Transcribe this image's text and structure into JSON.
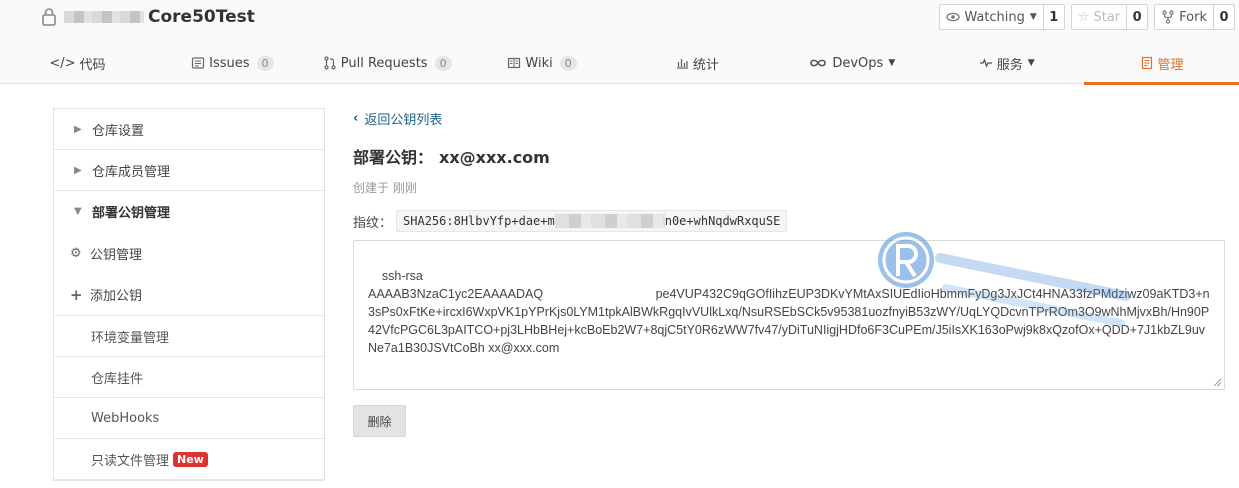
{
  "header": {
    "repo_name": "Core50Test",
    "watching_label": "Watching",
    "watching_count": "1",
    "star_label": "Star",
    "star_count": "0",
    "fork_label": "Fork",
    "fork_count": "0"
  },
  "tabs": [
    {
      "label": "代码",
      "badge": null
    },
    {
      "label": "Issues",
      "badge": "0"
    },
    {
      "label": "Pull Requests",
      "badge": "0"
    },
    {
      "label": "Wiki",
      "badge": "0"
    },
    {
      "label": "统计",
      "badge": null
    },
    {
      "label": "DevOps",
      "badge": null
    },
    {
      "label": "服务",
      "badge": null
    },
    {
      "label": "管理",
      "badge": null
    }
  ],
  "sidebar": {
    "items": [
      {
        "label": "仓库设置"
      },
      {
        "label": "仓库成员管理"
      },
      {
        "label": "部署公钥管理"
      }
    ],
    "subitems": [
      {
        "label": "公钥管理"
      },
      {
        "label": "添加公钥"
      }
    ],
    "plain": [
      {
        "label": "环境变量管理"
      },
      {
        "label": "仓库挂件"
      },
      {
        "label": "WebHooks"
      },
      {
        "label": "只读文件管理",
        "badge": "New"
      }
    ]
  },
  "main": {
    "back_label": "返回公钥列表",
    "title_prefix": "部署公钥：",
    "title_value": "xx@xxx.com",
    "created": "创建于 刚刚",
    "fingerprint_label": "指纹：",
    "fingerprint_start": "SHA256:8HlbvYfp+dae+m",
    "fingerprint_end": "n0e+whNqdwRxquSE",
    "key_text": "ssh-rsa\nAAAAB3NzaC1yc2EAAAADAQ　　　　　　　　　pe4VUP432C9qGOfIihzEUP3DKvYMtAxSIUEdIioHbmmFyDg3JxJCt4HNA33fzPMdziwz09aKTD3+n3sPs0xFtKe+ircxI6WxpVK1pYPrKjs0LYM1tpkAlBWkRgqIvVUlkLxq/NsuRSEbSCk5v95381uozfnyiB53zWY/UqLYQDcvnTPrROm3O9wNhMjvxBh/Hn90P42VfcPGC6L3pAITCO+pj3LHbBHej+kcBoEb2W7+8qjC5tY0R6zWW7fv47/yDiTuNIigjHDfo6F3CuPEm/J5iIsXK163oPwj9k8xQzofOx+QDD+7J1kbZL9uvNe7a1B30JSVtCoBh xx@xxx.com",
    "delete_label": "删除"
  },
  "colors": {
    "accent": "#e86f1f",
    "link": "#1d5f8a",
    "new_badge": "#dd3333"
  }
}
